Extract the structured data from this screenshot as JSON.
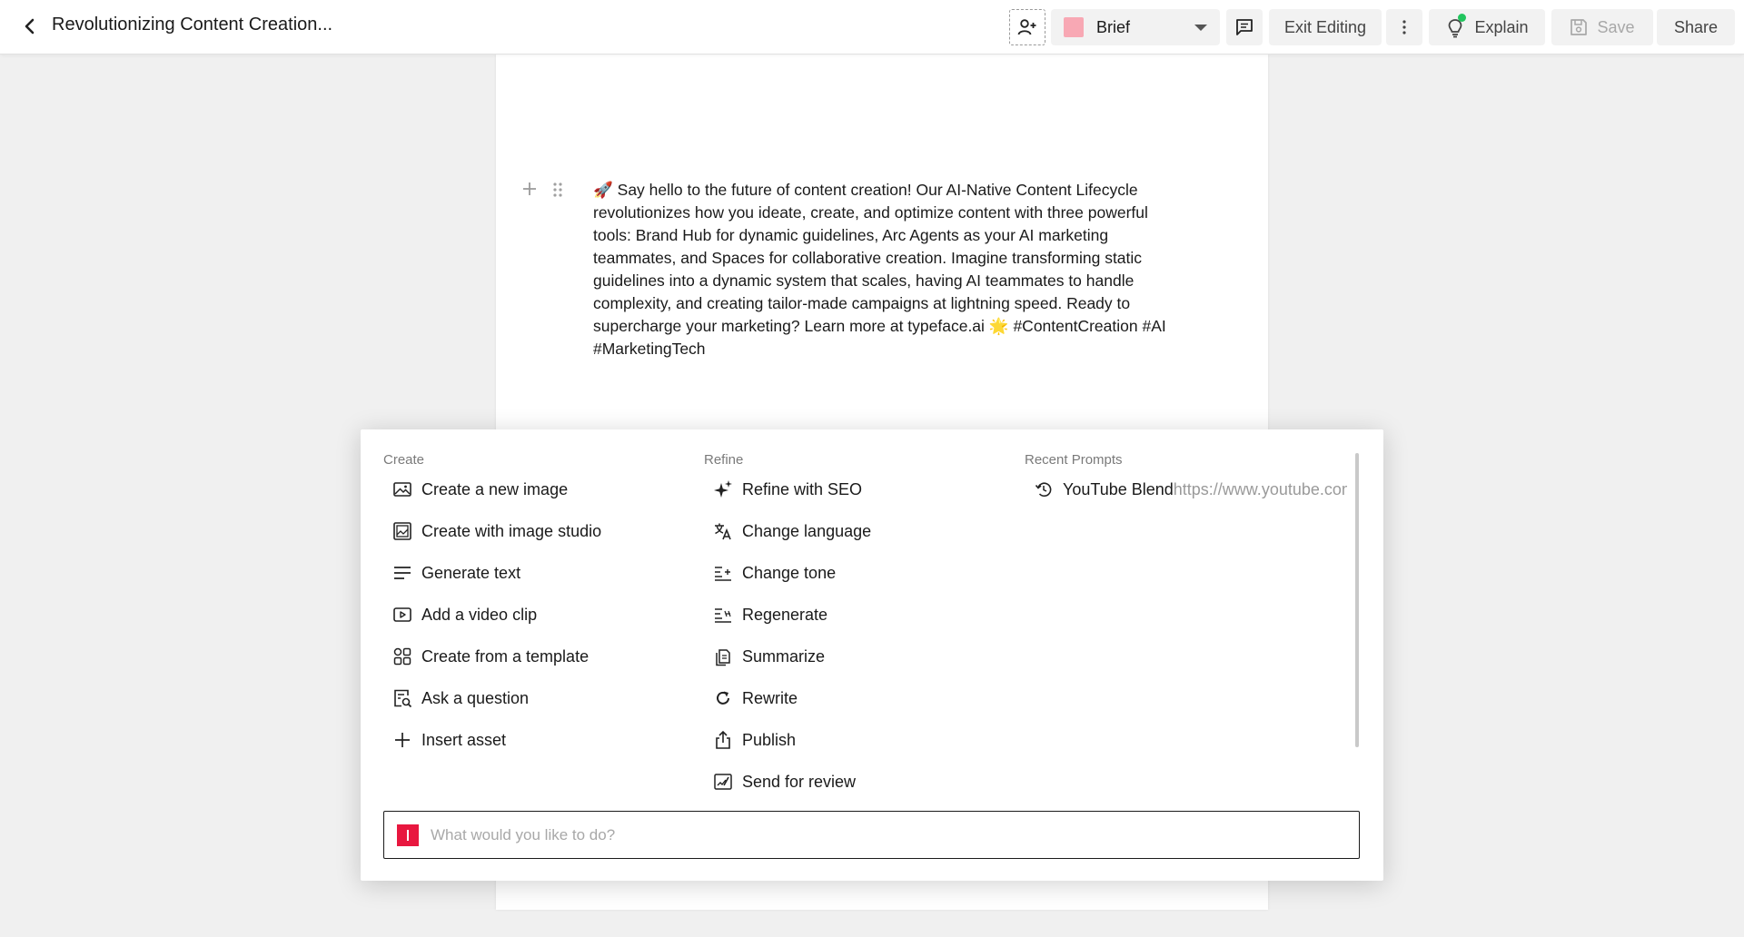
{
  "header": {
    "title": "Revolutionizing Content Creation...",
    "brief_label": "Brief",
    "brief_color": "#f8a8b4",
    "exit_label": "Exit Editing",
    "explain_label": "Explain",
    "save_label": "Save",
    "share_label": "Share"
  },
  "document": {
    "body": "🚀 Say hello to the future of content creation! Our AI-Native Content Lifecycle revolutionizes how you ideate, create, and optimize content with three powerful tools: Brand Hub for dynamic guidelines, Arc Agents as your AI marketing teammates, and Spaces for collaborative creation. Imagine transforming static guidelines into a dynamic system that scales, having AI teammates to handle complexity, and creating tailor-made campaigns at lightning speed. Ready to supercharge your marketing? Learn more at typeface.ai 🌟 #ContentCreation #AI #MarketingTech"
  },
  "palette": {
    "create_heading": "Create",
    "refine_heading": "Refine",
    "recent_heading": "Recent Prompts",
    "create_items": [
      {
        "label": "Create a new image",
        "icon": "image-icon"
      },
      {
        "label": "Create with image studio",
        "icon": "image-studio-icon"
      },
      {
        "label": "Generate text",
        "icon": "text-lines-icon"
      },
      {
        "label": "Add a video clip",
        "icon": "video-icon"
      },
      {
        "label": "Create from a template",
        "icon": "template-grid-icon"
      },
      {
        "label": "Ask a question",
        "icon": "question-search-icon"
      },
      {
        "label": "Insert asset",
        "icon": "plus-icon"
      }
    ],
    "refine_items": [
      {
        "label": "Refine with SEO",
        "icon": "sparkle-icon"
      },
      {
        "label": "Change language",
        "icon": "translate-icon"
      },
      {
        "label": "Change tone",
        "icon": "tone-icon"
      },
      {
        "label": "Regenerate",
        "icon": "regenerate-icon"
      },
      {
        "label": "Summarize",
        "icon": "summarize-icon"
      },
      {
        "label": "Rewrite",
        "icon": "rewrite-icon"
      },
      {
        "label": "Publish",
        "icon": "publish-icon"
      },
      {
        "label": "Send for review",
        "icon": "review-icon"
      }
    ],
    "recent_items": [
      {
        "title": "YouTube Blend",
        "url": "https://www.youtube.com",
        "icon": "history-icon"
      }
    ],
    "prompt_placeholder": "What would you like to do?"
  }
}
